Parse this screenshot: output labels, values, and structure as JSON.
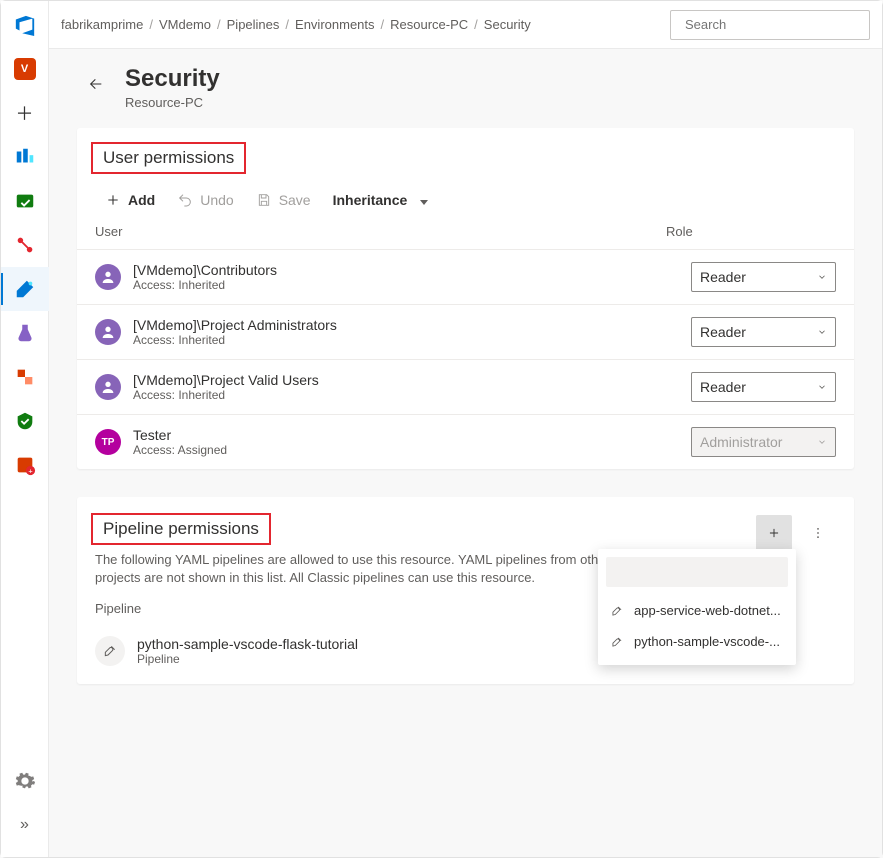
{
  "breadcrumb": [
    "fabrikamprime",
    "VMdemo",
    "Pipelines",
    "Environments",
    "Resource-PC",
    "Security"
  ],
  "search": {
    "placeholder": "Search"
  },
  "page": {
    "title": "Security",
    "subtitle": "Resource-PC"
  },
  "userPerm": {
    "title": "User permissions",
    "toolbar": {
      "add": "Add",
      "undo": "Undo",
      "save": "Save",
      "inheritance": "Inheritance"
    },
    "headers": {
      "user": "User",
      "role": "Role"
    },
    "rows": [
      {
        "name": "[VMdemo]\\Contributors",
        "access": "Access: Inherited",
        "role": "Reader",
        "avatar": "group",
        "disabled": false
      },
      {
        "name": "[VMdemo]\\Project Administrators",
        "access": "Access: Inherited",
        "role": "Reader",
        "avatar": "group",
        "disabled": false
      },
      {
        "name": "[VMdemo]\\Project Valid Users",
        "access": "Access: Inherited",
        "role": "Reader",
        "avatar": "group",
        "disabled": false
      },
      {
        "name": "Tester",
        "access": "Access: Assigned",
        "role": "Administrator",
        "avatar": "user",
        "initials": "TP",
        "disabled": true
      }
    ]
  },
  "pipePerm": {
    "title": "Pipeline permissions",
    "desc": "The following YAML pipelines are allowed to use this resource. YAML pipelines from other projects are not shown in this list. All Classic pipelines can use this resource.",
    "header": "Pipeline",
    "rows": [
      {
        "name": "python-sample-vscode-flask-tutorial",
        "type": "Pipeline"
      }
    ],
    "dropdown": [
      "app-service-web-dotnet...",
      "python-sample-vscode-..."
    ]
  },
  "rail": {
    "project_initial": "V"
  }
}
